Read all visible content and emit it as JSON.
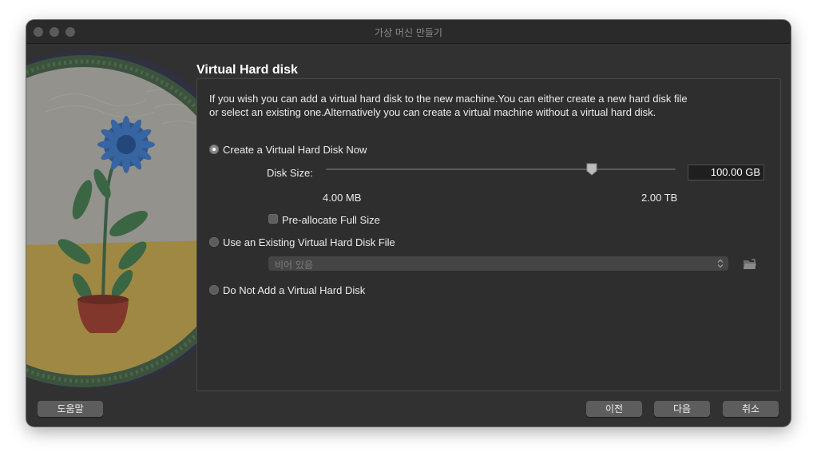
{
  "window": {
    "title": "가상 머신 만들기"
  },
  "page": {
    "heading": "Virtual Hard disk",
    "description": "If you wish you can add a virtual hard disk to the new machine.You can either create a new hard disk file or select an existing one.Alternatively you can create a virtual machine without a virtual hard disk."
  },
  "options": {
    "create_now": {
      "label": "Create a Virtual Hard Disk Now",
      "selected": true
    },
    "use_existing": {
      "label": "Use an Existing Virtual Hard Disk File",
      "selected": false
    },
    "do_not_add": {
      "label": "Do Not Add a Virtual Hard Disk",
      "selected": false
    }
  },
  "disk_size": {
    "label": "Disk Size:",
    "value": "100.00 GB",
    "min_label": "4.00 MB",
    "max_label": "2.00 TB",
    "slider_fraction": 0.76
  },
  "preallocate": {
    "label": "Pre-allocate Full Size",
    "checked": false
  },
  "existing_file": {
    "selected_value": "비어 있음"
  },
  "icons": {
    "folder": "folder-open-icon",
    "select_arrows": "chevron-up-down-icon",
    "slider_thumb": "slider-thumb-icon"
  },
  "buttons": {
    "help": "도움말",
    "back": "이전",
    "next": "다음",
    "cancel": "취소"
  },
  "colors": {
    "window_bg": "#313131",
    "panel_bg": "#2e2e2e",
    "button_bg": "#5d5d5d",
    "text": "#ececec"
  }
}
